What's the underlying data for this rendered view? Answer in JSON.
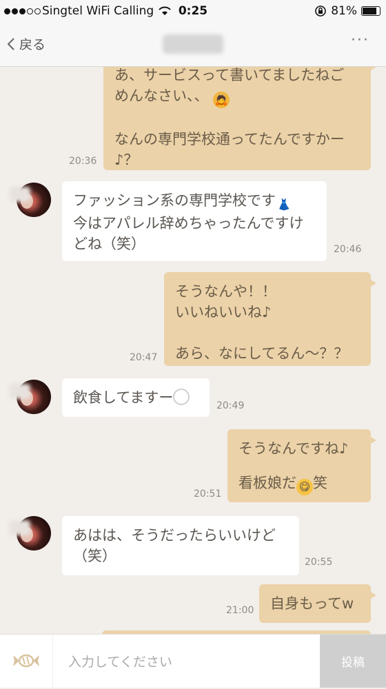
{
  "status_bar": {
    "carrier": "Singtel WiFi Calling",
    "time": "0:25",
    "battery": "81%"
  },
  "nav": {
    "back_label": "戻る",
    "more_label": "···"
  },
  "messages": [
    {
      "from": "me",
      "lines": [
        "あ、サービスって書いてましたねご",
        "めんなさい、、",
        "",
        "なんの専門学校通ってたんですかー",
        "♪？"
      ],
      "time": "20:36"
    },
    {
      "from": "other",
      "lines": [
        "ファッション系の専門学校です",
        "今はアパレル辞めちゃったんですけ",
        "どね（笑）"
      ],
      "time": "20:46"
    },
    {
      "from": "me",
      "lines": [
        "そうなんや！！",
        "いいねいいね♪",
        "",
        "あら、なにしてるん〜？？"
      ],
      "time": "20:47"
    },
    {
      "from": "other",
      "lines": [
        "飲食してますー"
      ],
      "time": "20:49"
    },
    {
      "from": "me",
      "lines": [
        "そうなんですね♪",
        "",
        "看板娘だ",
        "笑"
      ],
      "time": "20:51"
    },
    {
      "from": "other",
      "lines": [
        "あはは、そうだったらいいけど",
        "（笑）"
      ],
      "time": "20:55"
    },
    {
      "from": "me",
      "lines": [
        "自身もってw"
      ],
      "time": "21:00"
    }
  ],
  "input": {
    "placeholder": "入力してください",
    "post_label": "投稿"
  },
  "icons": [
    "wifi-icon",
    "lock-rotation-icon",
    "battery-icon",
    "back-chevron-icon",
    "more-icon",
    "candy-icon",
    "dress-emoji",
    "bow-emoji",
    "plate-emoji",
    "yum-emoji"
  ]
}
